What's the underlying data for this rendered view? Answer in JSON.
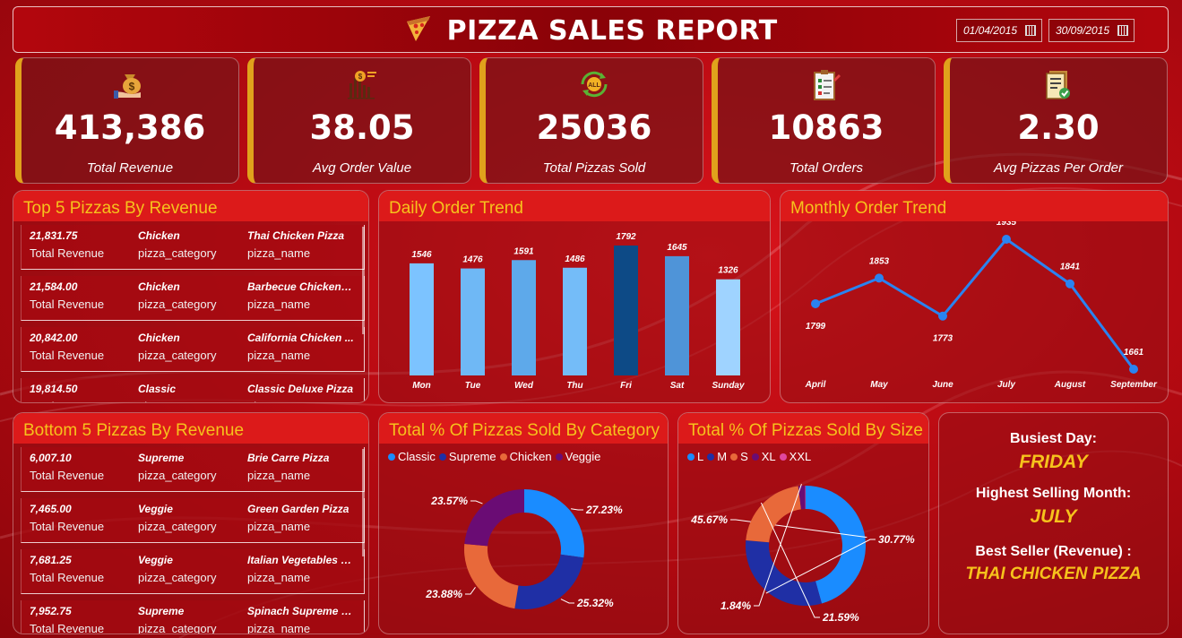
{
  "header": {
    "title": "PIZZA SALES REPORT",
    "start_date": "01/04/2015",
    "end_date": "30/09/2015"
  },
  "kpis": [
    {
      "value": "413,386",
      "label": "Total Revenue",
      "icon": "money-bag-icon"
    },
    {
      "value": "38.05",
      "label": "Avg Order Value",
      "icon": "bar-chart-dollar-icon"
    },
    {
      "value": "25036",
      "label": "Total Pizzas Sold",
      "icon": "all-cycle-icon"
    },
    {
      "value": "10863",
      "label": "Total Orders",
      "icon": "clipboard-checklist-icon"
    },
    {
      "value": "2.30",
      "label": "Avg Pizzas Per Order",
      "icon": "document-check-icon"
    }
  ],
  "top5": {
    "title": "Top 5 Pizzas By Revenue",
    "items": [
      {
        "revenue": "21,831.75",
        "category": "Chicken",
        "name": "Thai Chicken Pizza"
      },
      {
        "revenue": "21,584.00",
        "category": "Chicken",
        "name": "Barbecue Chicken P..."
      },
      {
        "revenue": "20,842.00",
        "category": "Chicken",
        "name": "California Chicken ..."
      },
      {
        "revenue": "19,814.50",
        "category": "Classic",
        "name": "Classic Deluxe Pizza"
      }
    ],
    "labels": {
      "revenue": "Total Revenue",
      "category": "pizza_category",
      "name": "pizza_name"
    }
  },
  "bottom5": {
    "title": "Bottom 5 Pizzas By Revenue",
    "items": [
      {
        "revenue": "6,007.10",
        "category": "Supreme",
        "name": "Brie Carre Pizza"
      },
      {
        "revenue": "7,465.00",
        "category": "Veggie",
        "name": "Green Garden Pizza"
      },
      {
        "revenue": "7,681.25",
        "category": "Veggie",
        "name": "Italian Vegetables P..."
      },
      {
        "revenue": "7,952.75",
        "category": "Supreme",
        "name": "Spinach Supreme Pi..."
      }
    ],
    "labels": {
      "revenue": "Total Revenue",
      "category": "pizza_category",
      "name": "pizza_name"
    }
  },
  "info": {
    "busiest_label": "Busiest Day:",
    "busiest_value": "FRIDAY",
    "month_label": "Highest Selling Month:",
    "month_value": "JULY",
    "best_label": "Best Seller (Revenue) :",
    "best_value": "THAI CHICKEN PIZZA"
  },
  "chart_data": [
    {
      "type": "bar",
      "title": "Daily Order Trend",
      "categories": [
        "Mon",
        "Tue",
        "Wed",
        "Thu",
        "Fri",
        "Sat",
        "Sunday"
      ],
      "values": [
        1546,
        1476,
        1591,
        1486,
        1792,
        1645,
        1326
      ],
      "colors": [
        "#7cc3ff",
        "#6fb8f5",
        "#5ea9ea",
        "#74bcf8",
        "#0d4a86",
        "#4f94d8",
        "#9fd3ff"
      ],
      "ylim": [
        0,
        1792
      ]
    },
    {
      "type": "line",
      "title": "Monthly Order Trend",
      "categories": [
        "April",
        "May",
        "June",
        "July",
        "August",
        "September"
      ],
      "values": [
        1799,
        1853,
        1773,
        1935,
        1841,
        1661
      ],
      "color": "#2a83f0"
    },
    {
      "type": "pie",
      "title": "Total % Of Pizzas Sold By Category",
      "labels": [
        "Classic",
        "Supreme",
        "Chicken",
        "Veggie"
      ],
      "values": [
        27.23,
        25.32,
        23.88,
        23.57
      ],
      "display": [
        "27.23%",
        "25.32%",
        "23.88%",
        "23.57%"
      ],
      "colors": [
        "#1a8cff",
        "#1f2fa5",
        "#e8693a",
        "#6a0c74"
      ]
    },
    {
      "type": "pie",
      "title": "Total % Of Pizzas Sold By Size",
      "labels": [
        "L",
        "M",
        "S",
        "XL",
        "XXL"
      ],
      "values": [
        45.67,
        30.77,
        21.59,
        1.84,
        0.13
      ],
      "display": [
        "45.67%",
        "30.77%",
        "21.59%",
        "1.84%",
        ""
      ],
      "colors": [
        "#1a8cff",
        "#1f2fa5",
        "#e8693a",
        "#6a0c74",
        "#e0479e"
      ]
    }
  ]
}
